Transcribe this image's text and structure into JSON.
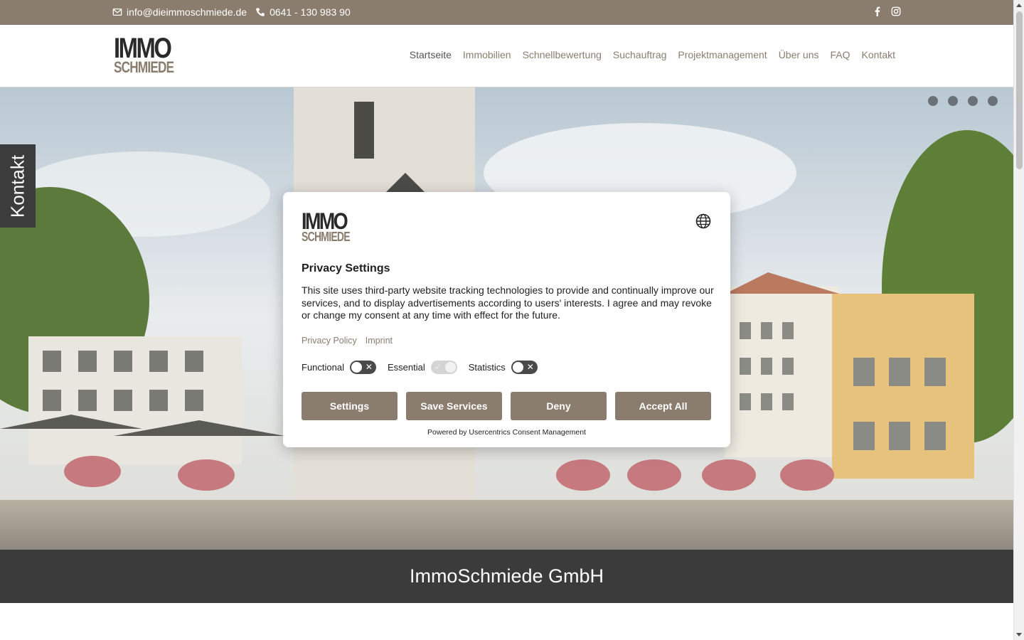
{
  "topbar": {
    "email": "info@dieimmoschmiede.de",
    "phone": "0641 - 130 983 90",
    "icons": [
      "envelope-icon",
      "phone-icon",
      "facebook-icon",
      "instagram-icon"
    ],
    "background": "#8a7d6e"
  },
  "header": {
    "logo_line1": "IMMO",
    "logo_line2": "SCHMIEDE",
    "nav": [
      {
        "label": "Startseite",
        "active": true
      },
      {
        "label": "Immobilien"
      },
      {
        "label": "Schnellbewertung"
      },
      {
        "label": "Suchauftrag"
      },
      {
        "label": "Projektmanagement"
      },
      {
        "label": "Über uns"
      },
      {
        "label": "FAQ"
      },
      {
        "label": "Kontakt"
      }
    ]
  },
  "side_tab": {
    "label": "Kontakt"
  },
  "banner": {
    "title": "ImmoSchmiede GmbH"
  },
  "consent": {
    "title": "Privacy Settings",
    "description": "This site uses third-party website tracking technologies to provide and continually improve our services, and to display advertisements according to users' interests. I agree and may revoke or change my consent at any time with effect for the future.",
    "links": {
      "privacy": "Privacy Policy",
      "imprint": "Imprint"
    },
    "toggles": [
      {
        "label": "Functional",
        "enabled": false
      },
      {
        "label": "Essential",
        "enabled": true
      },
      {
        "label": "Statistics",
        "enabled": false
      }
    ],
    "buttons": {
      "settings": "Settings",
      "save": "Save Services",
      "deny": "Deny",
      "accept": "Accept All"
    },
    "powered_by": "Powered by Usercentrics Consent Management"
  },
  "colors": {
    "accent": "#8a7d6e",
    "banner": "#3b3b3b"
  }
}
